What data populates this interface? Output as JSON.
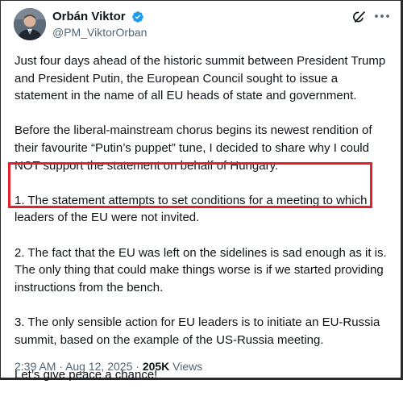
{
  "tweet": {
    "author_name": "Orbán Viktor",
    "author_handle": "@PM_ViktorOrban",
    "paragraphs": [
      "Just four days ahead of the historic summit between President Trump and President Putin, the European Council sought to issue a statement in the name of all EU heads of state and government.",
      "Before the liberal-mainstream chorus begins its newest rendition of their favourite “Putin’s puppet” tune, I decided to share why I could NOT support the statement on behalf of Hungary.",
      "1. The statement attempts to set conditions for a meeting to which leaders of the EU were not invited.",
      "2. The fact that the EU was left on the sidelines is sad enough as it is. The only thing that could make things worse is if we started providing instructions from the bench.",
      "3. The only sensible action for EU leaders is to initiate an EU-Russia summit, based on the example of the US-Russia meeting.",
      "Let’s give peace a chance!"
    ],
    "time": "2:39 AM",
    "separator": "·",
    "date": "Aug 12, 2025",
    "views_count": "205K",
    "views_label": "Views"
  },
  "colors": {
    "verified_badge": "#1d9bf0",
    "highlight_box": "#e4202c",
    "secondary_text": "#536471"
  },
  "icons": [
    "avatar",
    "verified-badge-icon",
    "grok-icon",
    "more-options-icon"
  ]
}
